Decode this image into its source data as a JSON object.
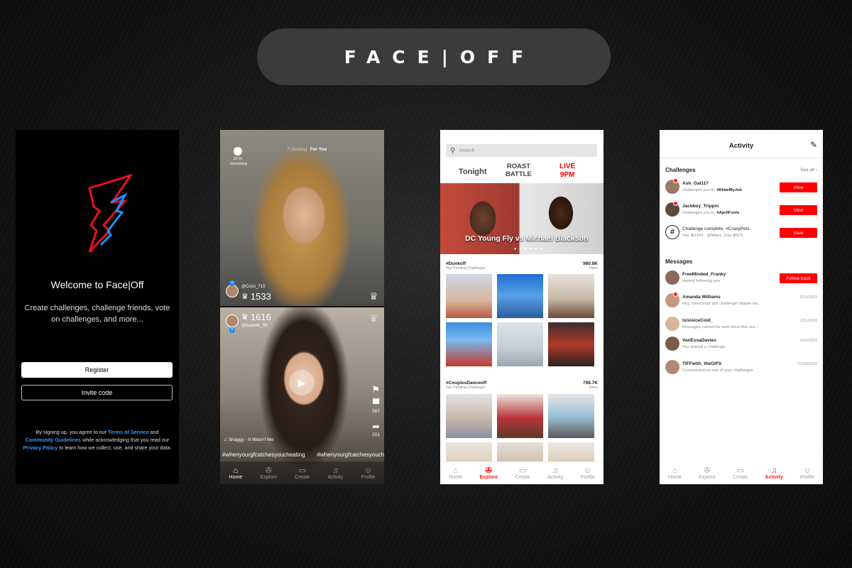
{
  "brand_title": "FACE|OFF",
  "welcome": {
    "heading": "Welcome to Face|Off",
    "subtitle": "Create challenges, challenge friends, vote on challenges, and more...",
    "register_label": "Register",
    "invite_label": "Invite code",
    "legal": {
      "p1": "By signing up, you agree to our ",
      "tos": "Terms of Service",
      "p2": " and ",
      "guidelines": "Community Guidelines",
      "p3": " while acknowledging that you read our ",
      "privacy": "Privacy Policy",
      "p4": " to learn how we collect, use, and share your data."
    },
    "colors": {
      "logo_red": "#e8101e",
      "logo_blue": "#1e90ff",
      "link": "#2d9cff"
    }
  },
  "feed": {
    "top_nav": {
      "following": "Following",
      "for_you": "For You"
    },
    "timer": {
      "line1": "20 hr",
      "line2": "remaining"
    },
    "video1": {
      "handle": "@Coco_715",
      "votes": "1533"
    },
    "video2": {
      "handle": "@isabelle_99",
      "votes": "1616",
      "song": "Shaggy - It Wasn't Me",
      "comments": "567",
      "shares": "201",
      "hashtags": [
        "#whenyourgfcatchesyoucheating",
        "#whenyourgfcatchesyoucheating"
      ]
    },
    "nav": [
      {
        "label": "Home",
        "icon": "home-icon"
      },
      {
        "label": "Explore",
        "icon": "telescope-icon"
      },
      {
        "label": "Create",
        "icon": "camera-icon"
      },
      {
        "label": "Activity",
        "icon": "bell-icon"
      },
      {
        "label": "Profile",
        "icon": "person-icon"
      }
    ],
    "active_nav": "Home"
  },
  "explore": {
    "search_placeholder": "Search",
    "promo": {
      "tonight": "Tonight",
      "roast1": "ROAST",
      "roast2": "BATTLE",
      "live1": "LIVE",
      "live2": "9PM"
    },
    "banner_caption": "DC Young Fly vs Michael Blackson",
    "sections": [
      {
        "tag": "#Dunkoff",
        "sub": "Top Trending Challenges",
        "count": "980.8K",
        "count_label": "Video"
      },
      {
        "tag": "#CouplesDanceoff",
        "sub": "Top Trending Challenges",
        "count": "798.7K",
        "count_label": "Video"
      }
    ],
    "nav": [
      {
        "label": "Home",
        "icon": "home-icon"
      },
      {
        "label": "Explore",
        "icon": "telescope-icon"
      },
      {
        "label": "Create",
        "icon": "camera-icon"
      },
      {
        "label": "Activity",
        "icon": "bell-icon"
      },
      {
        "label": "Profile",
        "icon": "person-icon"
      }
    ],
    "active_nav": "Explore"
  },
  "activity": {
    "title": "Activity",
    "challenges_title": "Challenges",
    "see_all": "See all",
    "challenges": [
      {
        "name": "Ash_Gal117",
        "text": "challenges you to: ",
        "tag": "#IHateMyJob",
        "button": "View"
      },
      {
        "name": "Jackboy_Trippin",
        "text": "challenges you to: ",
        "tag": "#AprilFools",
        "button": "View"
      },
      {
        "name": "Challenge complete: #CrazyPets",
        "text": "You  ♛1034 · @Mikey_Day  ♛875",
        "tag": "",
        "button": "View"
      }
    ],
    "messages_title": "Messages",
    "messages": [
      {
        "name": "FreeMinded_Franky",
        "text": "started following you",
        "right": "Follow back"
      },
      {
        "name": "Amanda Williams",
        "text": "Hey, loved your last challenge! Maybe we...",
        "right": "3/14/2022"
      },
      {
        "name": "IsisisiceCold_",
        "text": "Messages cannot be sent since this use...",
        "right": "2/11/2022"
      },
      {
        "name": "VanEssaDavies",
        "text": "You shared a challenge",
        "right": "2/10/2022"
      },
      {
        "name": "TIFFwith_theGIFS",
        "text": "Commented on one of your challenges",
        "right": "01/30/2022"
      }
    ],
    "nav": [
      {
        "label": "Home",
        "icon": "home-icon"
      },
      {
        "label": "Explore",
        "icon": "telescope-icon"
      },
      {
        "label": "Create",
        "icon": "camera-icon"
      },
      {
        "label": "Activity",
        "icon": "bell-icon"
      },
      {
        "label": "Profile",
        "icon": "person-icon"
      }
    ],
    "active_nav": "Activity",
    "accent_color": "#ff0000"
  }
}
